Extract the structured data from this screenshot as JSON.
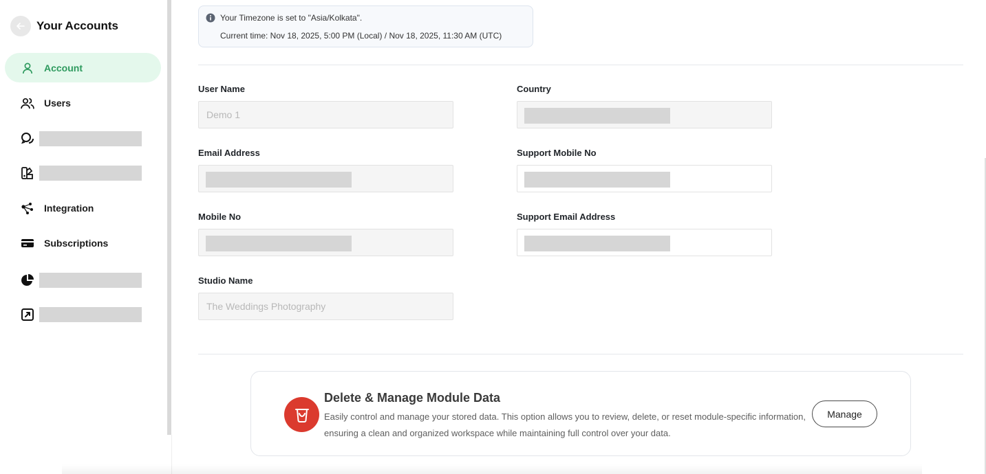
{
  "sidebar": {
    "title": "Your Accounts",
    "items": [
      {
        "label": "Account",
        "icon": "user-icon",
        "active": true
      },
      {
        "label": "Users",
        "icon": "users-icon"
      },
      {
        "label": "",
        "icon": "chat-bubbles-icon",
        "redacted": true
      },
      {
        "label": "",
        "icon": "branding-palette-icon",
        "redacted": true
      },
      {
        "label": "Integration",
        "icon": "integration-nodes-icon"
      },
      {
        "label": "Subscriptions",
        "icon": "credit-card-icon"
      },
      {
        "label": "",
        "icon": "pie-chart-icon",
        "redacted": true
      },
      {
        "label": "",
        "icon": "external-link-square-icon",
        "redacted": true
      }
    ]
  },
  "timezone": {
    "line1": "Your Timezone is set to \"Asia/Kolkata\".",
    "line2": "Current time: Nov 18, 2025, 5:00 PM (Local) / Nov 18, 2025, 11:30 AM (UTC)"
  },
  "form": {
    "user_name": {
      "label": "User Name",
      "value": "Demo 1"
    },
    "country": {
      "label": "Country",
      "value": ""
    },
    "email": {
      "label": "Email Address",
      "value": ""
    },
    "support_mobile": {
      "label": "Support Mobile No",
      "value": ""
    },
    "mobile": {
      "label": "Mobile No",
      "value": ""
    },
    "support_email": {
      "label": "Support Email Address",
      "value": ""
    },
    "studio_name": {
      "label": "Studio Name",
      "value": "The Weddings Photography"
    }
  },
  "manage_card": {
    "title": "Delete & Manage Module Data",
    "description": "Easily control and manage your stored data. This option allows you to review, delete, or reset module-specific information, ensuring a clean and organized workspace while maintaining full control over your data.",
    "button_label": "Manage"
  },
  "colors": {
    "accent_green": "#2e9a5e",
    "active_bg": "#e4f8ec",
    "danger_red": "#db3a2e"
  }
}
